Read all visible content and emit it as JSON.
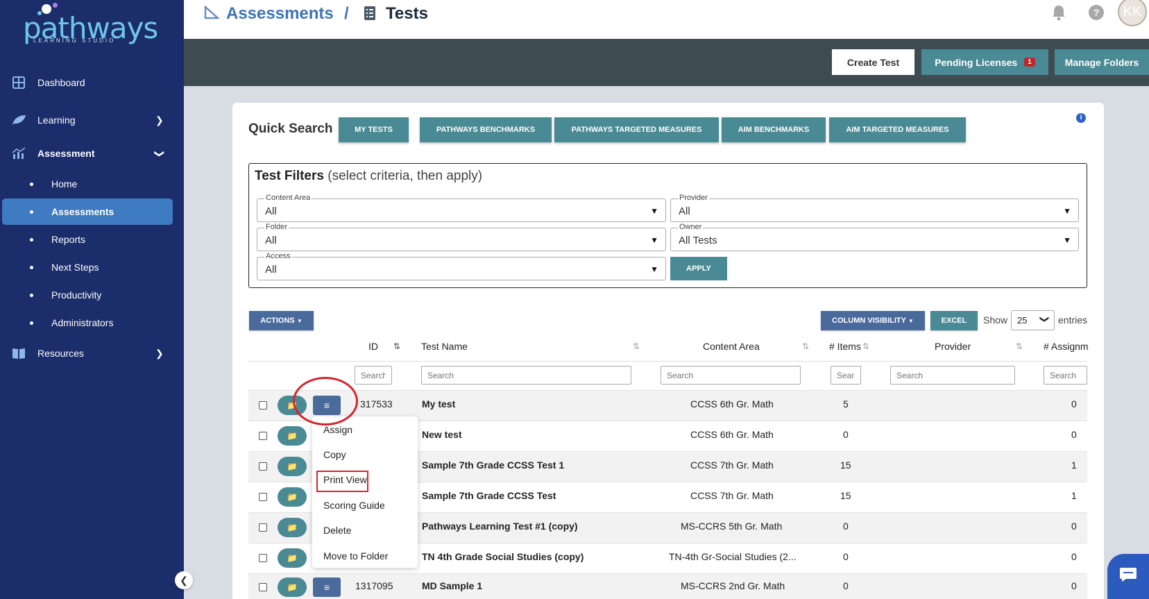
{
  "brand": {
    "name": "pathways",
    "sub": "LEARNING STUDIO"
  },
  "sidebar": {
    "items": [
      {
        "label": "Dashboard",
        "icon": "dashboard-icon"
      },
      {
        "label": "Learning",
        "icon": "leaf-icon"
      },
      {
        "label": "Assessment",
        "icon": "chart-icon"
      },
      {
        "label": "Resources",
        "icon": "book-icon"
      }
    ],
    "subitems": [
      {
        "label": "Home"
      },
      {
        "label": "Assessments"
      },
      {
        "label": "Reports"
      },
      {
        "label": "Next Steps"
      },
      {
        "label": "Productivity"
      },
      {
        "label": "Administrators"
      }
    ]
  },
  "header": {
    "breadcrumb_1": "Assessments",
    "separator": "/",
    "breadcrumb_2": "Tests",
    "avatar": "KK"
  },
  "toolbar": {
    "create_test": "Create Test",
    "pending_licenses": "Pending Licenses",
    "pending_count": "1",
    "manage_folders": "Manage Folders"
  },
  "quick_search": {
    "title": "Quick Search",
    "buttons": [
      "MY TESTS",
      "PATHWAYS BENCHMARKS",
      "PATHWAYS TARGETED MEASURES",
      "AIM BENCHMARKS",
      "AIM TARGETED MEASURES"
    ]
  },
  "filters": {
    "title": "Test Filters",
    "hint": "(select criteria, then apply)",
    "content_area": {
      "label": "Content Area",
      "value": "All"
    },
    "provider": {
      "label": "Provider",
      "value": "All"
    },
    "folder": {
      "label": "Folder",
      "value": "All"
    },
    "owner": {
      "label": "Owner",
      "value": "All Tests"
    },
    "access": {
      "label": "Access",
      "value": "All"
    },
    "apply": "APPLY"
  },
  "table_controls": {
    "actions": "ACTIONS",
    "column_visibility": "COLUMN VISIBILITY",
    "excel": "EXCEL",
    "show": "Show",
    "entries_value": "25",
    "entries": "entries"
  },
  "table": {
    "columns": [
      "ID",
      "Test Name",
      "Content Area",
      "# Items",
      "Provider",
      "# Assignm"
    ],
    "search_placeholder": "Search",
    "rows": [
      {
        "id": "317533",
        "name": "My test",
        "area": "CCSS 6th Gr. Math",
        "items": "5",
        "provider": "",
        "assign": "0"
      },
      {
        "id": "",
        "name": "New test",
        "area": "CCSS 6th Gr. Math",
        "items": "0",
        "provider": "",
        "assign": "0"
      },
      {
        "id": "",
        "name": "Sample 7th Grade CCSS Test 1",
        "area": "CCSS 7th Gr. Math",
        "items": "15",
        "provider": "",
        "assign": "1"
      },
      {
        "id": "",
        "name": "Sample 7th Grade CCSS Test",
        "area": "CCSS 7th Gr. Math",
        "items": "15",
        "provider": "",
        "assign": "1"
      },
      {
        "id": "",
        "name": "Pathways Learning Test #1 (copy)",
        "area": "MS-CCRS 5th Gr. Math",
        "items": "0",
        "provider": "",
        "assign": "0"
      },
      {
        "id": "",
        "name": "TN 4th Grade Social Studies (copy)",
        "area": "TN-4th Gr-Social Studies (2...",
        "items": "0",
        "provider": "",
        "assign": "0"
      },
      {
        "id": "1317095",
        "name": "MD Sample 1",
        "area": "MS-CCRS 2nd Gr. Math",
        "items": "0",
        "provider": "",
        "assign": "0"
      }
    ]
  },
  "row_menu": {
    "items": [
      "Assign",
      "Copy",
      "Print View",
      "Scoring Guide",
      "Delete",
      "Move to Folder"
    ]
  },
  "colors": {
    "sidebar": "#1b2d6b",
    "teal": "#4a8a94",
    "accent": "#3f7bc1",
    "highlight": "#d7242b"
  }
}
